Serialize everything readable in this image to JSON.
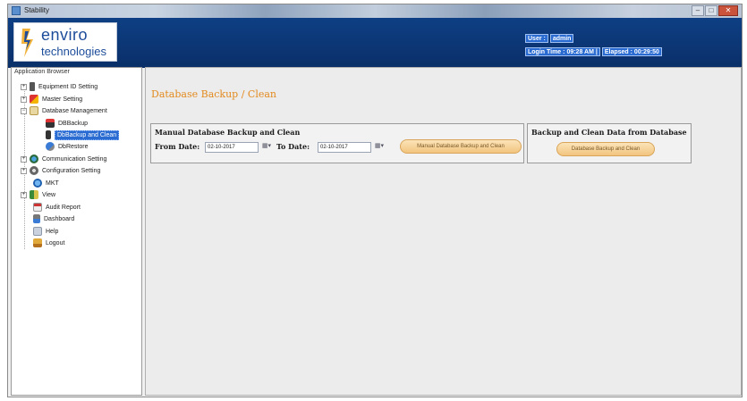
{
  "window": {
    "title": "Stability"
  },
  "logo": {
    "line1": "enviro",
    "line2": "technologies"
  },
  "user": {
    "label": "User :",
    "name": "admin",
    "login_label": "Login Time :",
    "login_time": "09:28 AM",
    "sep": "|",
    "elapsed_label": "Elapsed :",
    "elapsed_time": "00:29:50"
  },
  "sidebar": {
    "title": "Application Browser",
    "items": [
      {
        "label": "Equipment ID Setting",
        "expander": "+"
      },
      {
        "label": "Master Setting",
        "expander": "+"
      },
      {
        "label": "Database Management",
        "expander": "−"
      },
      {
        "label": "DBBackup"
      },
      {
        "label": "DbBackup and Clean"
      },
      {
        "label": "DbRestore"
      },
      {
        "label": "Communication Setting",
        "expander": "+"
      },
      {
        "label": "Configuration Setting",
        "expander": "+"
      },
      {
        "label": "MKT"
      },
      {
        "label": "View",
        "expander": "+"
      },
      {
        "label": "Audit Report"
      },
      {
        "label": "Dashboard"
      },
      {
        "label": "Help"
      },
      {
        "label": "Logout"
      }
    ]
  },
  "main": {
    "page_title": "Database Backup / Clean",
    "manual": {
      "title": "Manual Database Backup and Clean",
      "from_label": "From Date:",
      "from_value": "02-10-2017",
      "to_label": "To Date:",
      "to_value": "02-10-2017",
      "button": "Manual Database Backup and Clean"
    },
    "auto": {
      "title": "Backup and Clean Data from Database",
      "button": "Database Backup and Clean"
    }
  },
  "colors": {
    "header": "#0e3f84",
    "accent": "#e38a1e",
    "selection": "#2a6bd1",
    "button": "#f2c57f"
  }
}
